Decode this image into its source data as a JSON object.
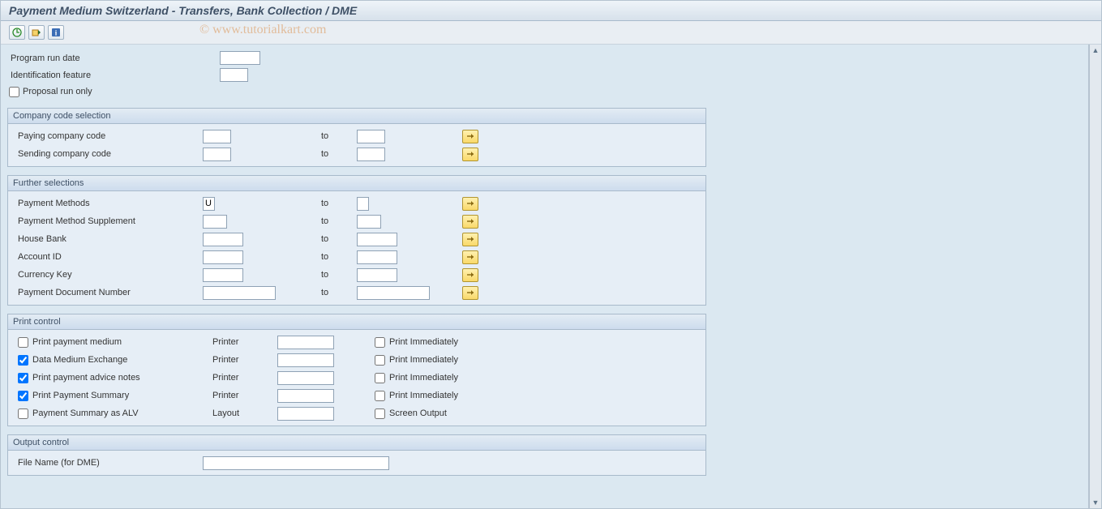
{
  "title": "Payment Medium Switzerland - Transfers, Bank Collection / DME",
  "watermark": "© www.tutorialkart.com",
  "toolbar": {
    "icons": [
      "execute-icon",
      "variant-icon",
      "info-icon"
    ]
  },
  "top": {
    "program_run_date_label": "Program run date",
    "program_run_date_value": "",
    "identification_label": "Identification feature",
    "identification_value": "",
    "proposal_label": "Proposal run only",
    "proposal_checked": false
  },
  "to_label": "to",
  "group_company": {
    "title": "Company code selection",
    "rows": [
      {
        "label": "Paying company code",
        "from": "",
        "to": ""
      },
      {
        "label": "Sending company code",
        "from": "",
        "to": ""
      }
    ]
  },
  "group_further": {
    "title": "Further selections",
    "rows": [
      {
        "label": "Payment Methods",
        "from": "U",
        "to": "",
        "fw": "w15",
        "tw": "w15"
      },
      {
        "label": "Payment Method Supplement",
        "from": "",
        "to": "",
        "fw": "w30",
        "tw": "w30"
      },
      {
        "label": "House Bank",
        "from": "",
        "to": "",
        "fw": "w50",
        "tw": "w50"
      },
      {
        "label": "Account ID",
        "from": "",
        "to": "",
        "fw": "w50",
        "tw": "w50"
      },
      {
        "label": "Currency Key",
        "from": "",
        "to": "",
        "fw": "w50",
        "tw": "w50"
      },
      {
        "label": "Payment Document Number",
        "from": "",
        "to": "",
        "fw": "w90",
        "tw": "w90"
      }
    ]
  },
  "group_print": {
    "title": "Print control",
    "printer_label": "Printer",
    "layout_label": "Layout",
    "immed_label": "Print Immediately",
    "screen_label": "Screen Output",
    "rows": [
      {
        "label": "Print payment medium",
        "checked": false,
        "mid": "Printer",
        "val": "",
        "r_label": "Print Immediately",
        "r_checked": false
      },
      {
        "label": "Data Medium Exchange",
        "checked": true,
        "mid": "Printer",
        "val": "",
        "r_label": "Print Immediately",
        "r_checked": false
      },
      {
        "label": "Print payment advice notes",
        "checked": true,
        "mid": "Printer",
        "val": "",
        "r_label": "Print Immediately",
        "r_checked": false
      },
      {
        "label": "Print Payment Summary",
        "checked": true,
        "mid": "Printer",
        "val": "",
        "r_label": "Print Immediately",
        "r_checked": false
      },
      {
        "label": "Payment Summary as ALV",
        "checked": false,
        "mid": "Layout",
        "val": "",
        "r_label": "Screen Output",
        "r_checked": false
      }
    ]
  },
  "group_output": {
    "title": "Output control",
    "file_name_label": "File Name (for DME)",
    "file_name_value": ""
  }
}
